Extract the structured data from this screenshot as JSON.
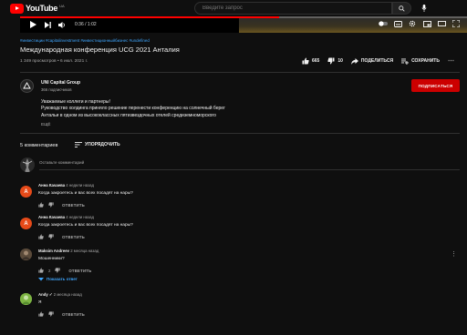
{
  "header": {
    "logo_text": "YouTube",
    "region": "UA",
    "search_placeholder": "Введите запрос"
  },
  "player": {
    "time": "0:36 / 1:02",
    "progress": 0.58
  },
  "video": {
    "hashtags": "#инвестиции #capitalinvestment #инвестиционныйбизнес #undefined",
    "title": "Международная конференция UCG 2021 Анталия",
    "meta": "1 349 просмотров • 6 июл. 2021 г.",
    "likes": "665",
    "dislikes": "10",
    "share_label": "ПОДЕЛИТЬСЯ",
    "save_label": "СОХРАНИТЬ"
  },
  "channel": {
    "name": "UNI Capital Group",
    "subscribers": "366 подписчиков",
    "subscribe_label": "ПОДПИСАТЬСЯ",
    "description": [
      "Уважаемые коллеги и партнеры!",
      "Руководство холдинга приняло решение перенести конференцию на солнечный берег",
      "Антальи в одном из высококлассных пятизвездочных отелей средиземноморского"
    ],
    "more_label": "ЕЩЁ"
  },
  "comments": {
    "count_label": "5 комментариев",
    "sort_label": "УПОРЯДОЧИТЬ",
    "add_placeholder": "Оставьте комментарий",
    "reply_label": "ОТВЕТИТЬ",
    "items": [
      {
        "initial": "A",
        "author": "Анна Качаева",
        "time": "4 недели назад",
        "text": "Когда закроетесь и вас всех посадят на нары?",
        "likes": "",
        "avatar_color": "#e64a19"
      },
      {
        "initial": "A",
        "author": "Анна Качаева",
        "time": "4 недели назад",
        "text": "Когда закроетесь и вас всех посадят на нары?",
        "likes": "",
        "avatar_color": "#e64a19"
      },
      {
        "initial": "",
        "author": "Maksim Andreev",
        "time": "2 месяца назад",
        "text": "Мошенники?",
        "likes": "2",
        "avatar_color": "#5a4a3a",
        "replies_label": "Показать ответ"
      },
      {
        "initial": "",
        "author": "Andy ✓",
        "time": "2 месяца назад",
        "text": "Я",
        "likes": "",
        "avatar_color": "#7cb342"
      }
    ]
  }
}
